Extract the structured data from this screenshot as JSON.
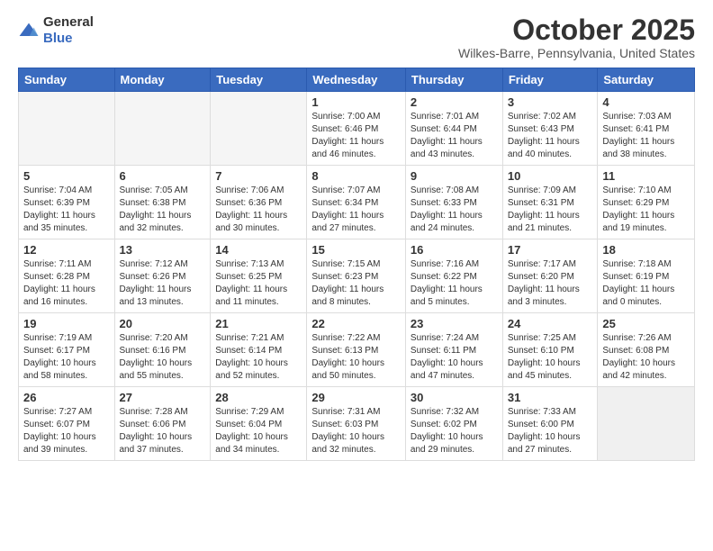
{
  "header": {
    "logo_general": "General",
    "logo_blue": "Blue",
    "month": "October 2025",
    "location": "Wilkes-Barre, Pennsylvania, United States"
  },
  "weekdays": [
    "Sunday",
    "Monday",
    "Tuesday",
    "Wednesday",
    "Thursday",
    "Friday",
    "Saturday"
  ],
  "weeks": [
    [
      {
        "day": "",
        "info": ""
      },
      {
        "day": "",
        "info": ""
      },
      {
        "day": "",
        "info": ""
      },
      {
        "day": "1",
        "info": "Sunrise: 7:00 AM\nSunset: 6:46 PM\nDaylight: 11 hours\nand 46 minutes."
      },
      {
        "day": "2",
        "info": "Sunrise: 7:01 AM\nSunset: 6:44 PM\nDaylight: 11 hours\nand 43 minutes."
      },
      {
        "day": "3",
        "info": "Sunrise: 7:02 AM\nSunset: 6:43 PM\nDaylight: 11 hours\nand 40 minutes."
      },
      {
        "day": "4",
        "info": "Sunrise: 7:03 AM\nSunset: 6:41 PM\nDaylight: 11 hours\nand 38 minutes."
      }
    ],
    [
      {
        "day": "5",
        "info": "Sunrise: 7:04 AM\nSunset: 6:39 PM\nDaylight: 11 hours\nand 35 minutes."
      },
      {
        "day": "6",
        "info": "Sunrise: 7:05 AM\nSunset: 6:38 PM\nDaylight: 11 hours\nand 32 minutes."
      },
      {
        "day": "7",
        "info": "Sunrise: 7:06 AM\nSunset: 6:36 PM\nDaylight: 11 hours\nand 30 minutes."
      },
      {
        "day": "8",
        "info": "Sunrise: 7:07 AM\nSunset: 6:34 PM\nDaylight: 11 hours\nand 27 minutes."
      },
      {
        "day": "9",
        "info": "Sunrise: 7:08 AM\nSunset: 6:33 PM\nDaylight: 11 hours\nand 24 minutes."
      },
      {
        "day": "10",
        "info": "Sunrise: 7:09 AM\nSunset: 6:31 PM\nDaylight: 11 hours\nand 21 minutes."
      },
      {
        "day": "11",
        "info": "Sunrise: 7:10 AM\nSunset: 6:29 PM\nDaylight: 11 hours\nand 19 minutes."
      }
    ],
    [
      {
        "day": "12",
        "info": "Sunrise: 7:11 AM\nSunset: 6:28 PM\nDaylight: 11 hours\nand 16 minutes."
      },
      {
        "day": "13",
        "info": "Sunrise: 7:12 AM\nSunset: 6:26 PM\nDaylight: 11 hours\nand 13 minutes."
      },
      {
        "day": "14",
        "info": "Sunrise: 7:13 AM\nSunset: 6:25 PM\nDaylight: 11 hours\nand 11 minutes."
      },
      {
        "day": "15",
        "info": "Sunrise: 7:15 AM\nSunset: 6:23 PM\nDaylight: 11 hours\nand 8 minutes."
      },
      {
        "day": "16",
        "info": "Sunrise: 7:16 AM\nSunset: 6:22 PM\nDaylight: 11 hours\nand 5 minutes."
      },
      {
        "day": "17",
        "info": "Sunrise: 7:17 AM\nSunset: 6:20 PM\nDaylight: 11 hours\nand 3 minutes."
      },
      {
        "day": "18",
        "info": "Sunrise: 7:18 AM\nSunset: 6:19 PM\nDaylight: 11 hours\nand 0 minutes."
      }
    ],
    [
      {
        "day": "19",
        "info": "Sunrise: 7:19 AM\nSunset: 6:17 PM\nDaylight: 10 hours\nand 58 minutes."
      },
      {
        "day": "20",
        "info": "Sunrise: 7:20 AM\nSunset: 6:16 PM\nDaylight: 10 hours\nand 55 minutes."
      },
      {
        "day": "21",
        "info": "Sunrise: 7:21 AM\nSunset: 6:14 PM\nDaylight: 10 hours\nand 52 minutes."
      },
      {
        "day": "22",
        "info": "Sunrise: 7:22 AM\nSunset: 6:13 PM\nDaylight: 10 hours\nand 50 minutes."
      },
      {
        "day": "23",
        "info": "Sunrise: 7:24 AM\nSunset: 6:11 PM\nDaylight: 10 hours\nand 47 minutes."
      },
      {
        "day": "24",
        "info": "Sunrise: 7:25 AM\nSunset: 6:10 PM\nDaylight: 10 hours\nand 45 minutes."
      },
      {
        "day": "25",
        "info": "Sunrise: 7:26 AM\nSunset: 6:08 PM\nDaylight: 10 hours\nand 42 minutes."
      }
    ],
    [
      {
        "day": "26",
        "info": "Sunrise: 7:27 AM\nSunset: 6:07 PM\nDaylight: 10 hours\nand 39 minutes."
      },
      {
        "day": "27",
        "info": "Sunrise: 7:28 AM\nSunset: 6:06 PM\nDaylight: 10 hours\nand 37 minutes."
      },
      {
        "day": "28",
        "info": "Sunrise: 7:29 AM\nSunset: 6:04 PM\nDaylight: 10 hours\nand 34 minutes."
      },
      {
        "day": "29",
        "info": "Sunrise: 7:31 AM\nSunset: 6:03 PM\nDaylight: 10 hours\nand 32 minutes."
      },
      {
        "day": "30",
        "info": "Sunrise: 7:32 AM\nSunset: 6:02 PM\nDaylight: 10 hours\nand 29 minutes."
      },
      {
        "day": "31",
        "info": "Sunrise: 7:33 AM\nSunset: 6:00 PM\nDaylight: 10 hours\nand 27 minutes."
      },
      {
        "day": "",
        "info": ""
      }
    ]
  ]
}
